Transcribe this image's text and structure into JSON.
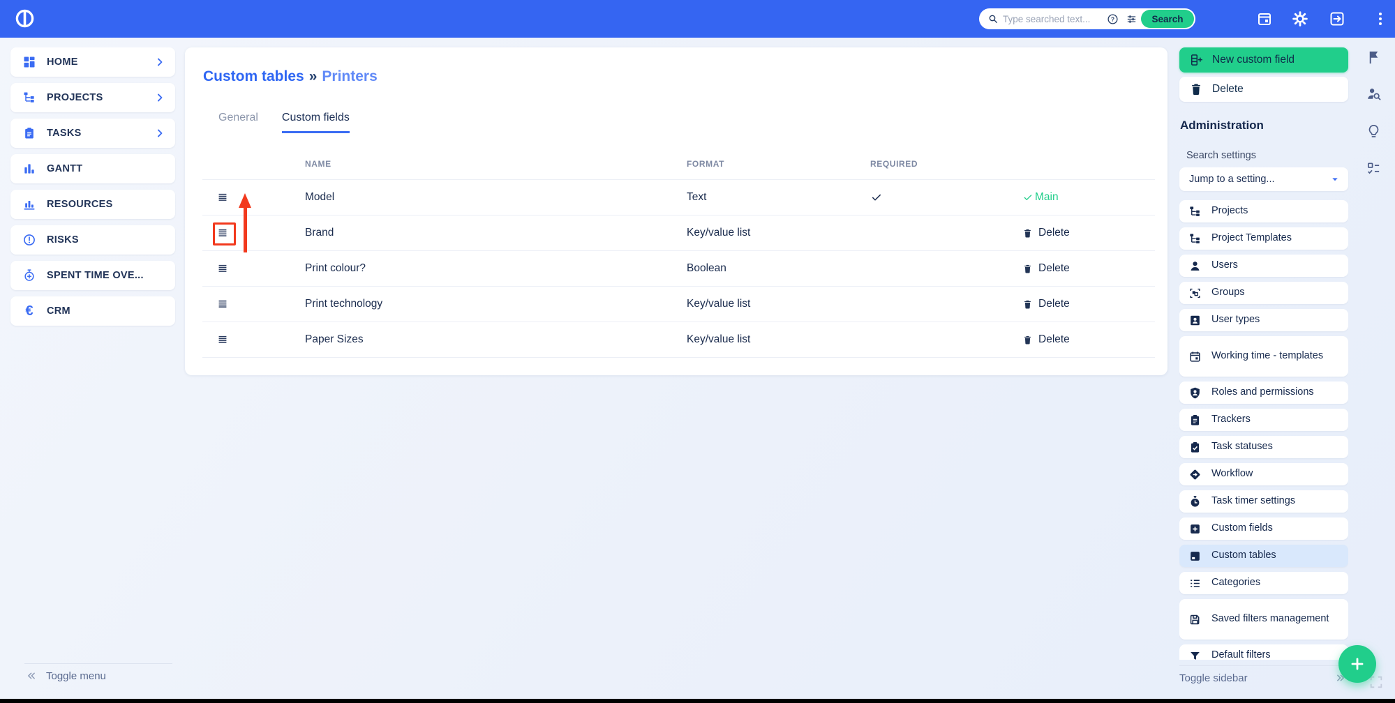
{
  "topbar": {
    "search_placeholder": "Type searched text...",
    "search_button": "Search"
  },
  "left_menu": {
    "items": [
      {
        "label": "HOME",
        "icon": "dashboard"
      },
      {
        "label": "PROJECTS",
        "icon": "tree"
      },
      {
        "label": "TASKS",
        "icon": "clipboard"
      },
      {
        "label": "GANTT",
        "icon": "gantt"
      },
      {
        "label": "RESOURCES",
        "icon": "barchart"
      },
      {
        "label": "RISKS",
        "icon": "alert-circle"
      },
      {
        "label": "SPENT TIME OVE...",
        "icon": "stopwatch-plus"
      },
      {
        "label": "CRM",
        "icon": "euro"
      }
    ],
    "toggle_label": "Toggle menu"
  },
  "main": {
    "breadcrumb": {
      "parent": "Custom tables",
      "separator": "»",
      "current": "Printers"
    },
    "tabs": {
      "general": "General",
      "custom_fields": "Custom fields"
    },
    "table": {
      "headers": {
        "name": "NAME",
        "format": "FORMAT",
        "required": "REQUIRED"
      },
      "rows": [
        {
          "name": "Model",
          "format": "Text",
          "required": "✓",
          "action": "Main"
        },
        {
          "name": "Brand",
          "format": "Key/value list",
          "required": "",
          "action": "Delete"
        },
        {
          "name": "Print colour?",
          "format": "Boolean",
          "required": "",
          "action": "Delete"
        },
        {
          "name": "Print technology",
          "format": "Key/value list",
          "required": "",
          "action": "Delete"
        },
        {
          "name": "Paper Sizes",
          "format": "Key/value list",
          "required": "",
          "action": "Delete"
        }
      ]
    }
  },
  "sidebar": {
    "new_button": "New custom field",
    "delete_button": "Delete",
    "section_title": "Administration",
    "search_label": "Search settings",
    "jump_placeholder": "Jump to a setting...",
    "items": [
      {
        "label": "Projects",
        "icon": "tree"
      },
      {
        "label": "Project Templates",
        "icon": "tree"
      },
      {
        "label": "Users",
        "icon": "person"
      },
      {
        "label": "Groups",
        "icon": "groups"
      },
      {
        "label": "User types",
        "icon": "id-badge"
      },
      {
        "label": "Working time - templates",
        "icon": "calendar"
      },
      {
        "label": "Roles and permissions",
        "icon": "shield-person"
      },
      {
        "label": "Trackers",
        "icon": "clipboard"
      },
      {
        "label": "Task statuses",
        "icon": "clipboard-check"
      },
      {
        "label": "Workflow",
        "icon": "workflow"
      },
      {
        "label": "Task timer settings",
        "icon": "stopwatch"
      },
      {
        "label": "Custom fields",
        "icon": "plus-square"
      },
      {
        "label": "Custom tables",
        "icon": "table-card"
      },
      {
        "label": "Categories",
        "icon": "list"
      },
      {
        "label": "Saved filters management",
        "icon": "save"
      },
      {
        "label": "Default filters",
        "icon": "funnel"
      }
    ],
    "toggle_label": "Toggle sidebar"
  },
  "colors": {
    "topbar_blue": "#3565f2",
    "accent_green": "#21ce8b",
    "navy": "#16294d",
    "annotation_red": "#f2391d",
    "selected_item_bg": "#d9e8fc"
  }
}
